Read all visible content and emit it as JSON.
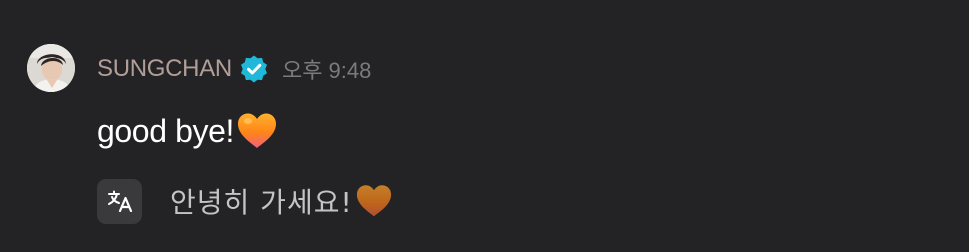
{
  "message": {
    "author": "SUNGCHAN",
    "timestamp": "오후 9:48",
    "text": "good bye!",
    "translation": "안녕히 가세요!",
    "icons": {
      "verified": "verified-badge-icon",
      "heart": "orange-heart-icon",
      "translate": "translate-icon"
    },
    "colors": {
      "background": "#232325",
      "author": "#b29e98",
      "timestamp": "#7b7b7e",
      "verified": "#1fb8d9",
      "heart": "#ff8a1c"
    }
  }
}
